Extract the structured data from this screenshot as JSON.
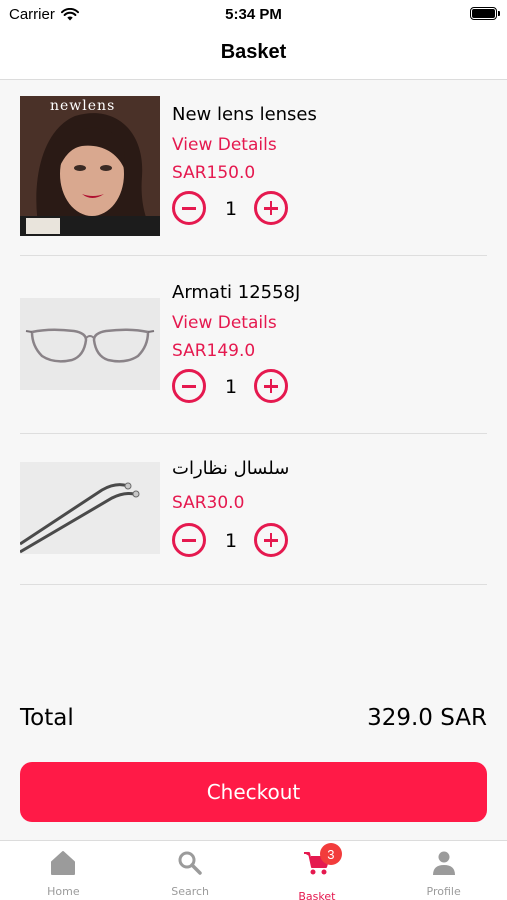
{
  "status_bar": {
    "carrier": "Carrier",
    "time": "5:34 PM"
  },
  "nav": {
    "title": "Basket"
  },
  "items": [
    {
      "name": "New lens lenses",
      "view_details": "View Details",
      "price": "SAR150.0",
      "quantity": "1",
      "image": "woman-portrait-lens-box",
      "image_brand_text": "newlens"
    },
    {
      "name": "Armati 12558J",
      "view_details": "View Details",
      "price": "SAR149.0",
      "quantity": "1",
      "image": "eyeglasses-frame"
    },
    {
      "name": "سلسال نظارات",
      "price": "SAR30.0",
      "quantity": "1",
      "image": "glasses-chain"
    }
  ],
  "summary": {
    "total_label": "Total",
    "total_value": "329.0 SAR"
  },
  "checkout": {
    "label": "Checkout"
  },
  "tabs": [
    {
      "label": "Home",
      "icon": "home-icon"
    },
    {
      "label": "Search",
      "icon": "search-icon"
    },
    {
      "label": "Basket",
      "icon": "cart-icon",
      "badge": "3",
      "active": true
    },
    {
      "label": "Profile",
      "icon": "person-icon"
    }
  ],
  "colors": {
    "accent": "#e5194f",
    "checkout_button": "#ff1a47",
    "badge": "#f23c3c",
    "inactive_tab": "#9b9b9b"
  }
}
